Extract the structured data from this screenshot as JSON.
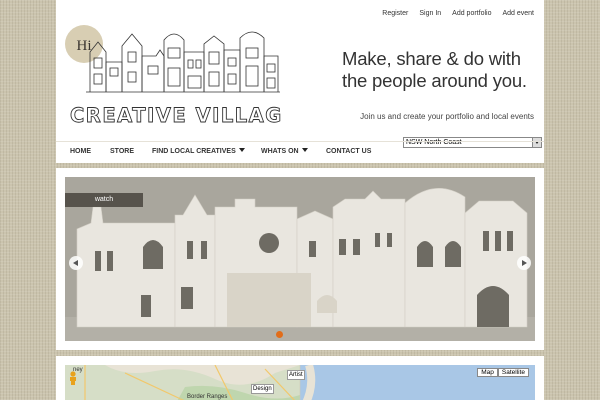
{
  "header": {
    "top_links": [
      "Register",
      "Sign In",
      "Add portfolio",
      "Add event"
    ],
    "logo": {
      "badge_text": "Hi",
      "title": "CREATIVE VILLAGE"
    },
    "tagline": "Make, share & do with the people around you.",
    "subline": "Join us and create your portfolio and local events"
  },
  "nav": {
    "items": [
      {
        "label": "HOME",
        "has_dropdown": false
      },
      {
        "label": "STORE",
        "has_dropdown": false
      },
      {
        "label": "FIND LOCAL CREATIVES",
        "has_dropdown": true
      },
      {
        "label": "WHATS ON",
        "has_dropdown": true
      },
      {
        "label": "CONTACT US",
        "has_dropdown": false
      }
    ],
    "region_select": {
      "selected": "NSW North Coast"
    }
  },
  "slider": {
    "tab_label": "watch",
    "active_index": 0,
    "slide_count": 1
  },
  "map": {
    "map_button": "Map",
    "satellite_button": "Satellite",
    "labels": {
      "place_1": "ney",
      "place_2": "Border Ranges",
      "place_3": "Design",
      "place_4": "Artist"
    }
  },
  "colors": {
    "background": "#cbc4ae",
    "accent": "#e26d1a",
    "text": "#333333",
    "panel": "#ffffff",
    "sea": "#a9c7e6"
  }
}
